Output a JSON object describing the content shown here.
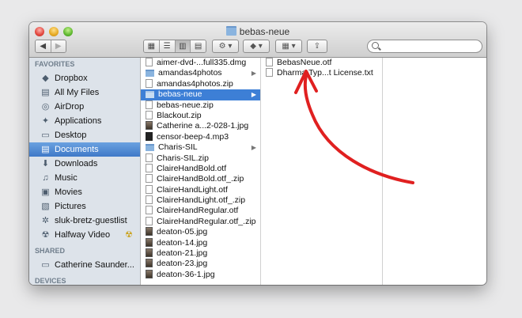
{
  "window": {
    "title": "bebas-neue"
  },
  "toolbar": {
    "back_icon": "back-arrow-icon",
    "forward_icon": "forward-arrow-icon",
    "search_placeholder": ""
  },
  "sidebar": {
    "favorites_header": "FAVORITES",
    "favorites": [
      {
        "label": "Dropbox",
        "icon": "◆"
      },
      {
        "label": "All My Files",
        "icon": "▤"
      },
      {
        "label": "AirDrop",
        "icon": "◎"
      },
      {
        "label": "Applications",
        "icon": "✦"
      },
      {
        "label": "Desktop",
        "icon": "▭"
      },
      {
        "label": "Documents",
        "icon": "▤",
        "selected": true
      },
      {
        "label": "Downloads",
        "icon": "⬇"
      },
      {
        "label": "Music",
        "icon": "♫"
      },
      {
        "label": "Movies",
        "icon": "▣"
      },
      {
        "label": "Pictures",
        "icon": "▧"
      },
      {
        "label": "sluk-bretz-guestlist",
        "icon": "✲"
      },
      {
        "label": "Halfway Video",
        "icon": "☢"
      }
    ],
    "shared_header": "SHARED",
    "shared": [
      {
        "label": "Catherine Saunder...",
        "icon": "▭"
      }
    ],
    "devices_header": "DEVICES"
  },
  "column1": [
    {
      "name": "aimer-dvd-...full335.dmg",
      "type": "file"
    },
    {
      "name": "amandas4photos",
      "type": "folder"
    },
    {
      "name": "amandas4photos.zip",
      "type": "file"
    },
    {
      "name": "bebas-neue",
      "type": "folder",
      "selected": true
    },
    {
      "name": "bebas-neue.zip",
      "type": "file"
    },
    {
      "name": "Blackout.zip",
      "type": "file"
    },
    {
      "name": "Catherine a...2-028-1.jpg",
      "type": "img"
    },
    {
      "name": "censor-beep-4.mp3",
      "type": "mp3"
    },
    {
      "name": "Charis-SIL",
      "type": "folder"
    },
    {
      "name": "Charis-SIL.zip",
      "type": "file"
    },
    {
      "name": "ClaireHandBold.otf",
      "type": "file"
    },
    {
      "name": "ClaireHandBold.otf_.zip",
      "type": "file"
    },
    {
      "name": "ClaireHandLight.otf",
      "type": "file"
    },
    {
      "name": "ClaireHandLight.otf_.zip",
      "type": "file"
    },
    {
      "name": "ClaireHandRegular.otf",
      "type": "file"
    },
    {
      "name": "ClaireHandRegular.otf_.zip",
      "type": "file"
    },
    {
      "name": "deaton-05.jpg",
      "type": "img"
    },
    {
      "name": "deaton-14.jpg",
      "type": "img"
    },
    {
      "name": "deaton-21.jpg",
      "type": "img"
    },
    {
      "name": "deaton-23.jpg",
      "type": "img"
    },
    {
      "name": "deaton-36-1.jpg",
      "type": "img"
    }
  ],
  "column2": [
    {
      "name": "BebasNeue.otf",
      "type": "file"
    },
    {
      "name": "Dharma Typ...t License.txt",
      "type": "file"
    }
  ],
  "colors": {
    "selection": "#3d7fd6",
    "sidebar_bg": "#dde3ea",
    "annotation": "#e02020"
  }
}
